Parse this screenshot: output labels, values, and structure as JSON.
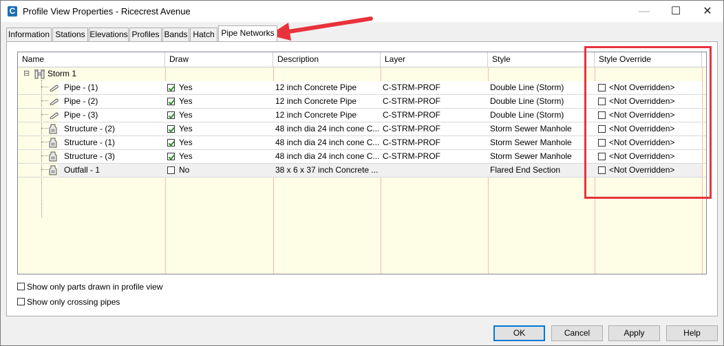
{
  "window": {
    "app_icon": "C",
    "title": "Profile View Properties - Ricecrest Avenue",
    "controls": [
      "minimize-icon",
      "maximize-icon",
      "close-icon"
    ],
    "minimize_glyph": "—",
    "maximize_glyph": "☐",
    "close_glyph": "✕"
  },
  "tabs": [
    {
      "label": "Information",
      "active": false
    },
    {
      "label": "Stations",
      "active": false
    },
    {
      "label": "Elevations",
      "active": false
    },
    {
      "label": "Profiles",
      "active": false
    },
    {
      "label": "Bands",
      "active": false
    },
    {
      "label": "Hatch",
      "active": false
    },
    {
      "label": "Pipe Networks",
      "active": true
    }
  ],
  "grid": {
    "columns": [
      "Name",
      "Draw",
      "Description",
      "Layer",
      "Style",
      "Style Override"
    ],
    "group": {
      "label": "Storm 1",
      "expander": "⊟"
    },
    "rows": [
      {
        "name": "Pipe - (1)",
        "icon": "pipe-icon",
        "draw_checked": true,
        "draw": "Yes",
        "description": "12 inch Concrete Pipe",
        "layer": "C-STRM-PROF",
        "style": "Double Line (Storm)",
        "override": "<Not Overridden>",
        "selected": false
      },
      {
        "name": "Pipe - (2)",
        "icon": "pipe-icon",
        "draw_checked": true,
        "draw": "Yes",
        "description": "12 inch Concrete Pipe",
        "layer": "C-STRM-PROF",
        "style": "Double Line (Storm)",
        "override": "<Not Overridden>",
        "selected": false
      },
      {
        "name": "Pipe - (3)",
        "icon": "pipe-icon",
        "draw_checked": true,
        "draw": "Yes",
        "description": "12 inch Concrete Pipe",
        "layer": "C-STRM-PROF",
        "style": "Double Line (Storm)",
        "override": "<Not Overridden>",
        "selected": false
      },
      {
        "name": "Structure - (2)",
        "icon": "structure-icon",
        "draw_checked": true,
        "draw": "Yes",
        "description": "48 inch dia 24 inch cone C...",
        "layer": "C-STRM-PROF",
        "style": "Storm Sewer Manhole",
        "override": "<Not Overridden>",
        "selected": false
      },
      {
        "name": "Structure - (1)",
        "icon": "structure-icon",
        "draw_checked": true,
        "draw": "Yes",
        "description": "48 inch dia 24 inch cone C...",
        "layer": "C-STRM-PROF",
        "style": "Storm Sewer Manhole",
        "override": "<Not Overridden>",
        "selected": false
      },
      {
        "name": "Structure - (3)",
        "icon": "structure-icon",
        "draw_checked": true,
        "draw": "Yes",
        "description": "48 inch dia 24 inch cone C...",
        "layer": "C-STRM-PROF",
        "style": "Storm Sewer Manhole",
        "override": "<Not Overridden>",
        "selected": false
      },
      {
        "name": "Outfall - 1",
        "icon": "structure-icon",
        "draw_checked": false,
        "draw": "No",
        "description": "38 x 6 x 37 inch Concrete ...",
        "layer": "",
        "style": "Flared End Section",
        "override": "<Not Overridden>",
        "selected": true
      }
    ]
  },
  "options": {
    "show_only_drawn": "Show only parts drawn in profile view",
    "show_only_crossing": "Show only crossing pipes"
  },
  "buttons": {
    "ok": "OK",
    "cancel": "Cancel",
    "apply": "Apply",
    "help": "Help"
  },
  "annotation_colors": {
    "arrow": "#e8323c",
    "box": "#e8323c"
  }
}
